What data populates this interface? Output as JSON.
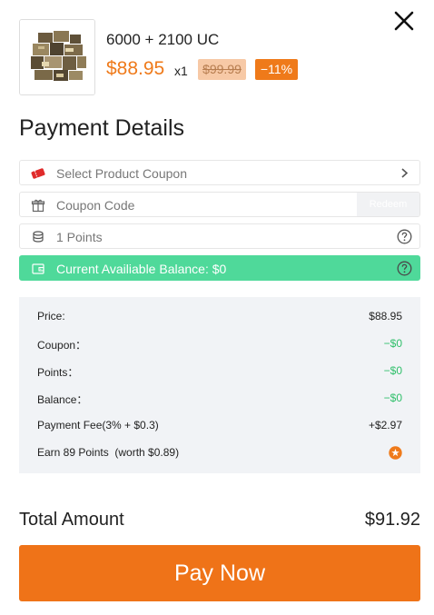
{
  "product": {
    "image_icon": "crate-bundle-image",
    "name": "6000 + 2100 UC",
    "price": "$88.95",
    "quantity": "x1",
    "original_price": "$99.99",
    "discount": "−11%"
  },
  "close_icon": "close-icon",
  "payment_details": {
    "title": "Payment Details",
    "select_coupon": {
      "icon": "ticket-icon",
      "label": "Select Product Coupon",
      "end_icon": "chevron-right-icon"
    },
    "coupon_code": {
      "icon": "gift-icon",
      "placeholder": "Coupon Code",
      "button": "Redeem"
    },
    "points": {
      "icon": "coins-icon",
      "label": "1 Points",
      "end_icon": "help-icon"
    },
    "balance": {
      "icon": "wallet-icon",
      "label": "Current Availiable Balance: $0",
      "end_icon": "help-icon"
    }
  },
  "summary": {
    "rows": [
      {
        "label": "Price:",
        "value": "$88.95"
      },
      {
        "label": "Coupon：",
        "value": "−$0"
      },
      {
        "label": "Points：",
        "value": "−$0"
      },
      {
        "label": "Balance：",
        "value": "−$0"
      },
      {
        "label": "Payment Fee(3% + $0.3)",
        "value": "+$2.97"
      }
    ],
    "earn": {
      "label": "Earn 89 Points  (worth $0.89)",
      "icon": "star-badge-icon"
    }
  },
  "total": {
    "label": "Total Amount",
    "value": "$91.92"
  },
  "pay_button": "Pay Now",
  "colors": {
    "accent": "#ef7a1a",
    "pay_button": "#ef7318",
    "balance_bar": "#4fd99a",
    "negative_value": "#2fbf6a",
    "summary_bg": "#f1f3f6"
  }
}
